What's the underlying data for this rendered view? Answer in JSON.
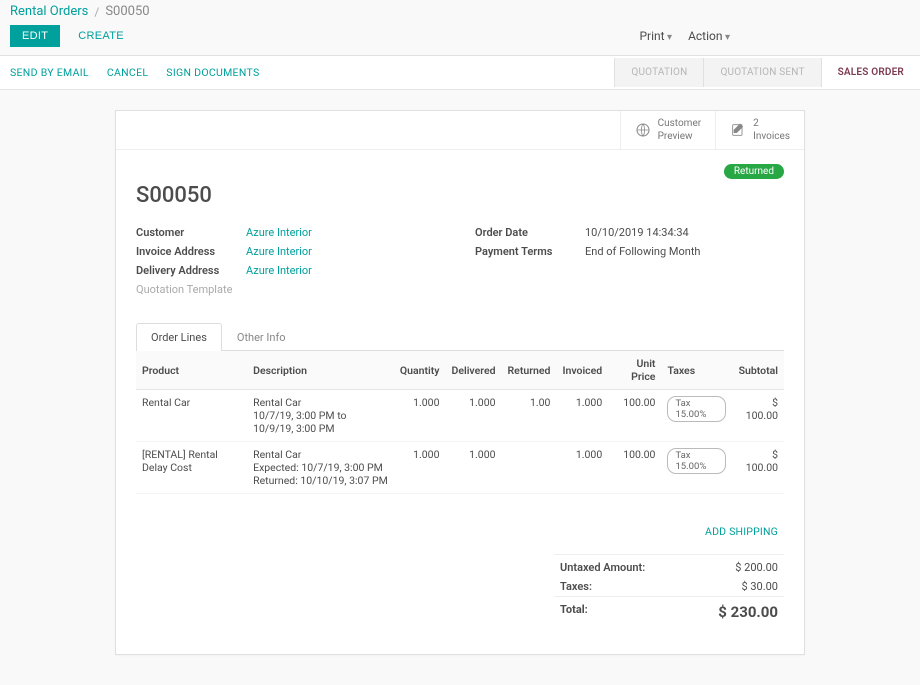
{
  "breadcrumb": {
    "root": "Rental Orders",
    "current": "S00050"
  },
  "buttons": {
    "edit": "EDIT",
    "create": "CREATE",
    "print": "Print",
    "action": "Action"
  },
  "statusbar": {
    "left": [
      "SEND BY EMAIL",
      "CANCEL",
      "SIGN DOCUMENTS"
    ],
    "stages": [
      "QUOTATION",
      "QUOTATION SENT",
      "SALES ORDER"
    ]
  },
  "stat_buttons": {
    "preview": {
      "l1": "Customer",
      "l2": "Preview"
    },
    "invoices": {
      "count": "2",
      "label": "Invoices"
    }
  },
  "ribbon": "Returned",
  "order_name": "S00050",
  "fields": {
    "left": [
      {
        "label": "Customer",
        "value": "Azure Interior",
        "link": true
      },
      {
        "label": "Invoice Address",
        "value": "Azure Interior",
        "link": true
      },
      {
        "label": "Delivery Address",
        "value": "Azure Interior",
        "link": true
      },
      {
        "label": "Quotation Template",
        "value": "",
        "muted": true
      }
    ],
    "right": [
      {
        "label": "Order Date",
        "value": "10/10/2019 14:34:34"
      },
      {
        "label": "Payment Terms",
        "value": "End of Following Month"
      }
    ]
  },
  "tabs": [
    "Order Lines",
    "Other Info"
  ],
  "columns": [
    "Product",
    "Description",
    "Quantity",
    "Delivered",
    "Returned",
    "Invoiced",
    "Unit Price",
    "Taxes",
    "Subtotal"
  ],
  "lines": [
    {
      "product": "Rental Car",
      "description": "Rental Car\n10/7/19, 3:00 PM to 10/9/19, 3:00 PM",
      "quantity": "1.000",
      "delivered": "1.000",
      "returned": "1.00",
      "invoiced": "1.000",
      "unit_price": "100.00",
      "taxes": "Tax 15.00%",
      "subtotal": "$ 100.00"
    },
    {
      "product": "[RENTAL] Rental Delay Cost",
      "description": "Rental Car\nExpected: 10/7/19, 3:00 PM\nReturned: 10/10/19, 3:07 PM",
      "quantity": "1.000",
      "delivered": "1.000",
      "returned": "",
      "invoiced": "1.000",
      "unit_price": "100.00",
      "taxes": "Tax 15.00%",
      "subtotal": "$ 100.00"
    }
  ],
  "add_shipping": "ADD SHIPPING",
  "totals": {
    "untaxed_label": "Untaxed Amount:",
    "untaxed": "$ 200.00",
    "taxes_label": "Taxes:",
    "taxes": "$ 30.00",
    "total_label": "Total:",
    "total": "$ 230.00"
  }
}
